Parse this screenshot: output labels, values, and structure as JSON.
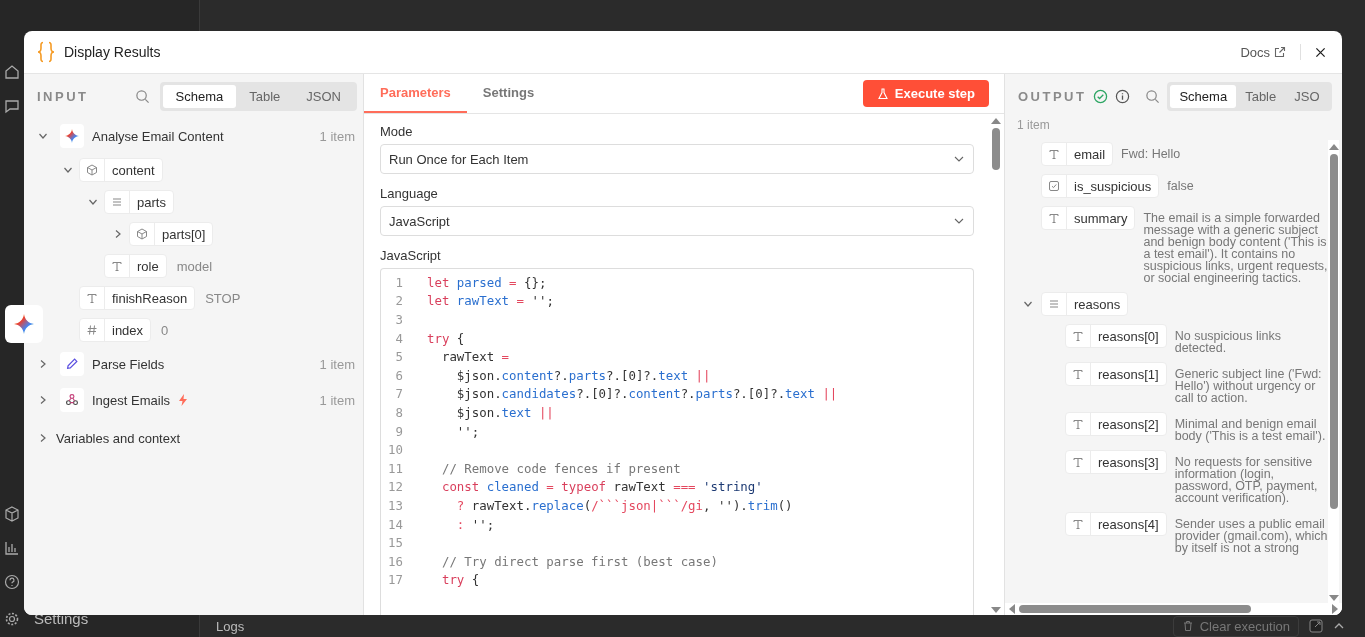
{
  "background": {
    "sidebar_bottom": {
      "label": "Settings"
    },
    "logs": {
      "label": "Logs"
    },
    "clear_button": {
      "label": "Clear execution"
    }
  },
  "window": {
    "title": "Display Results",
    "docs_link": "Docs"
  },
  "input": {
    "label": "INPUT",
    "tabs": [
      {
        "label": "Schema",
        "selected": true
      },
      {
        "label": "Table",
        "selected": false
      },
      {
        "label": "JSON",
        "selected": false
      }
    ],
    "sources": [
      {
        "name": "Analyse Email Content",
        "kind": "sparkle",
        "count": "1 item",
        "expanded": true,
        "trigger": false,
        "fields": [
          {
            "kind": "object",
            "key": "content",
            "expanded": true,
            "children": [
              {
                "kind": "array",
                "key": "parts",
                "expanded": true,
                "children": [
                  {
                    "kind": "object",
                    "key": "parts[0]",
                    "expanded": false
                  }
                ]
              },
              {
                "kind": "string",
                "key": "role",
                "value": "model"
              }
            ]
          },
          {
            "kind": "string",
            "key": "finishReason",
            "value": "STOP"
          },
          {
            "kind": "number",
            "key": "index",
            "value": "0"
          }
        ]
      },
      {
        "name": "Parse Fields",
        "kind": "pen",
        "count": "1 item",
        "expanded": false,
        "trigger": false
      },
      {
        "name": "Ingest Emails",
        "kind": "webhook",
        "count": "1 item",
        "expanded": false,
        "trigger": true
      }
    ],
    "context": {
      "label": "Variables and context",
      "expanded": false
    }
  },
  "parameters": {
    "tabs": [
      {
        "label": "Parameters",
        "selected": true
      },
      {
        "label": "Settings",
        "selected": false
      }
    ],
    "execute_button": "Execute step",
    "mode": {
      "label": "Mode",
      "value": "Run Once for Each Item"
    },
    "language": {
      "label": "Language",
      "value": "JavaScript"
    },
    "code": {
      "label": "JavaScript",
      "lines": [
        {
          "number": "1",
          "tokens": [
            {
              "kind": "keyword",
              "text": "let"
            },
            {
              "kind": "name",
              "text": " parsed"
            },
            {
              "kind": "operator",
              "text": " ="
            },
            {
              "kind": "plain",
              "text": " {};"
            }
          ]
        },
        {
          "number": "2",
          "tokens": [
            {
              "kind": "keyword",
              "text": "let"
            },
            {
              "kind": "name",
              "text": " rawText"
            },
            {
              "kind": "operator",
              "text": " ="
            },
            {
              "kind": "plain",
              "text": " '';"
            }
          ]
        },
        {
          "number": "3"
        },
        {
          "number": "4",
          "tokens": [
            {
              "kind": "keyword",
              "text": "try"
            },
            {
              "kind": "plain",
              "text": " {"
            }
          ]
        },
        {
          "number": "5",
          "tokens": [
            {
              "kind": "plain",
              "text": "  rawText"
            },
            {
              "kind": "operator",
              "text": " ="
            }
          ]
        },
        {
          "number": "6",
          "tokens": [
            {
              "kind": "plain",
              "text": "    $json."
            },
            {
              "kind": "name",
              "text": "content"
            },
            {
              "kind": "plain",
              "text": "?."
            },
            {
              "kind": "name",
              "text": "parts"
            },
            {
              "kind": "plain",
              "text": "?.[0]?."
            },
            {
              "kind": "name",
              "text": "text"
            },
            {
              "kind": "operator",
              "text": " ||"
            }
          ]
        },
        {
          "number": "7",
          "tokens": [
            {
              "kind": "plain",
              "text": "    $json."
            },
            {
              "kind": "name",
              "text": "candidates"
            },
            {
              "kind": "plain",
              "text": "?.[0]?."
            },
            {
              "kind": "name",
              "text": "content"
            },
            {
              "kind": "plain",
              "text": "?."
            },
            {
              "kind": "name",
              "text": "parts"
            },
            {
              "kind": "plain",
              "text": "?.[0]?."
            },
            {
              "kind": "name",
              "text": "text"
            },
            {
              "kind": "operator",
              "text": " ||"
            }
          ]
        },
        {
          "number": "8",
          "tokens": [
            {
              "kind": "plain",
              "text": "    $json."
            },
            {
              "kind": "name",
              "text": "text"
            },
            {
              "kind": "operator",
              "text": " ||"
            }
          ]
        },
        {
          "number": "9",
          "tokens": [
            {
              "kind": "plain",
              "text": "    '';"
            }
          ]
        },
        {
          "number": "10"
        },
        {
          "number": "11",
          "tokens": [
            {
              "kind": "comment",
              "text": "  // Remove code fences if present"
            }
          ]
        },
        {
          "number": "12",
          "tokens": [
            {
              "kind": "keyword",
              "text": "  const"
            },
            {
              "kind": "name",
              "text": " cleaned"
            },
            {
              "kind": "operator",
              "text": " ="
            },
            {
              "kind": "keyword",
              "text": " typeof"
            },
            {
              "kind": "plain",
              "text": " rawText"
            },
            {
              "kind": "operator",
              "text": " ==="
            },
            {
              "kind": "string",
              "text": " 'string'"
            }
          ]
        },
        {
          "number": "13",
          "tokens": [
            {
              "kind": "operator",
              "text": "    ?"
            },
            {
              "kind": "plain",
              "text": " rawText."
            },
            {
              "kind": "name",
              "text": "replace"
            },
            {
              "kind": "plain",
              "text": "("
            },
            {
              "kind": "operator",
              "text": "/```json|```/gi"
            },
            {
              "kind": "plain",
              "text": ", '')."
            },
            {
              "kind": "name",
              "text": "trim"
            },
            {
              "kind": "plain",
              "text": "()"
            }
          ]
        },
        {
          "number": "14",
          "tokens": [
            {
              "kind": "operator",
              "text": "    :"
            },
            {
              "kind": "plain",
              "text": " '';"
            }
          ]
        },
        {
          "number": "15"
        },
        {
          "number": "16",
          "tokens": [
            {
              "kind": "comment",
              "text": "  // Try direct parse first (best case)"
            }
          ]
        },
        {
          "number": "17",
          "tokens": [
            {
              "kind": "keyword",
              "text": "  try"
            },
            {
              "kind": "plain",
              "text": " {"
            }
          ]
        }
      ]
    }
  },
  "output": {
    "label": "OUTPUT",
    "success": true,
    "tabs": [
      {
        "label": "Schema",
        "selected": true
      },
      {
        "label": "Table",
        "selected": false
      },
      {
        "label": "JSO",
        "selected": false
      }
    ],
    "count": "1 item",
    "fields": [
      {
        "kind": "string",
        "key": "email",
        "value": "Fwd: Hello"
      },
      {
        "kind": "boolean",
        "key": "is_suspicious",
        "value": "false"
      },
      {
        "kind": "string",
        "key": "summary",
        "value": "The email is a simple forwarded message with a generic subject and benign body content ('This is a test email'). It contains no suspicious links, urgent requests, or social engineering tactics."
      },
      {
        "kind": "array",
        "key": "reasons",
        "expanded": true,
        "children": [
          {
            "kind": "string",
            "key": "reasons[0]",
            "value": "No suspicious links detected."
          },
          {
            "kind": "string",
            "key": "reasons[1]",
            "value": "Generic subject line ('Fwd: Hello') without urgency or call to action."
          },
          {
            "kind": "string",
            "key": "reasons[2]",
            "value": "Minimal and benign email body ('This is a test email')."
          },
          {
            "kind": "string",
            "key": "reasons[3]",
            "value": "No requests for sensitive information (login, password, OTP, payment, account verification)."
          },
          {
            "kind": "string",
            "key": "reasons[4]",
            "value": "Sender uses a public email provider (gmail.com), which by itself is not a strong"
          }
        ]
      }
    ]
  }
}
